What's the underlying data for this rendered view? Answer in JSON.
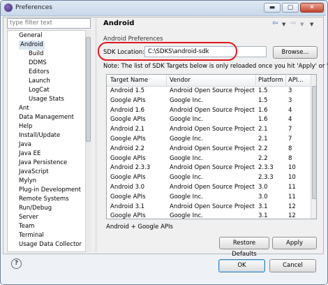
{
  "window": {
    "title": "Preferences",
    "minimize": "▬",
    "maximize": "▢",
    "close": "✕"
  },
  "filter": {
    "placeholder": "type filter text"
  },
  "tree": [
    {
      "label": "General",
      "indent": 0
    },
    {
      "label": "Android",
      "indent": 0,
      "selected": true
    },
    {
      "label": "Build",
      "indent": 1
    },
    {
      "label": "DDMS",
      "indent": 1
    },
    {
      "label": "Editors",
      "indent": 1
    },
    {
      "label": "Launch",
      "indent": 1
    },
    {
      "label": "LogCat",
      "indent": 1
    },
    {
      "label": "Usage Stats",
      "indent": 1
    },
    {
      "label": "Ant",
      "indent": 0
    },
    {
      "label": "Data Management",
      "indent": 0
    },
    {
      "label": "Help",
      "indent": 0
    },
    {
      "label": "Install/Update",
      "indent": 0
    },
    {
      "label": "Java",
      "indent": 0
    },
    {
      "label": "Java EE",
      "indent": 0
    },
    {
      "label": "Java Persistence",
      "indent": 0
    },
    {
      "label": "JavaScript",
      "indent": 0
    },
    {
      "label": "Mylyn",
      "indent": 0
    },
    {
      "label": "Plug-in Development",
      "indent": 0
    },
    {
      "label": "Remote Systems",
      "indent": 0
    },
    {
      "label": "Run/Debug",
      "indent": 0
    },
    {
      "label": "Server",
      "indent": 0
    },
    {
      "label": "Team",
      "indent": 0
    },
    {
      "label": "Terminal",
      "indent": 0
    },
    {
      "label": "Usage Data Collector",
      "indent": 0
    }
  ],
  "page": {
    "title": "Android",
    "section_label": "Android Preferences",
    "sdk_location_label": "SDK Location:",
    "sdk_location_value": "C:\\SDKS\\android-sdk",
    "browse_label": "Browse...",
    "note": "Note: The list of SDK Targets below is only reloaded once you hit 'Apply' or 'OK'.",
    "selected_status": "Android + Google APIs",
    "restore_label": "Restore Defaults",
    "apply_label": "Apply"
  },
  "table": {
    "headers": [
      "Target Name",
      "Vendor",
      "Platform",
      "API..."
    ],
    "rows": [
      [
        "Android 1.5",
        "Android Open Source Project",
        "1.5",
        "3"
      ],
      [
        "Google APIs",
        "Google Inc.",
        "1.5",
        "3"
      ],
      [
        "Android 1.6",
        "Android Open Source Project",
        "1.6",
        "4"
      ],
      [
        "Google APIs",
        "Google Inc.",
        "1.6",
        "4"
      ],
      [
        "Android 2.1",
        "Android Open Source Project",
        "2.1",
        "7"
      ],
      [
        "Google APIs",
        "Google Inc.",
        "2.1",
        "7"
      ],
      [
        "Android 2.2",
        "Android Open Source Project",
        "2.2",
        "8"
      ],
      [
        "Google APIs",
        "Google Inc.",
        "2.2",
        "8"
      ],
      [
        "Android 2.3.3",
        "Android Open Source Project",
        "2.3.3",
        "10"
      ],
      [
        "Google APIs",
        "Google Inc.",
        "2.3.3",
        "10"
      ],
      [
        "Android 3.0",
        "Android Open Source Project",
        "3.0",
        "11"
      ],
      [
        "Google APIs",
        "Google Inc.",
        "3.0",
        "11"
      ],
      [
        "Android 3.1",
        "Android Open Source Project",
        "3.1",
        "12"
      ],
      [
        "Google APIs",
        "Google Inc.",
        "3.1",
        "12"
      ]
    ]
  },
  "footer": {
    "help_icon": "?",
    "ok_label": "OK",
    "cancel_label": "Cancel"
  },
  "colors": {
    "highlight_ring": "#e0181f",
    "selection": "#dde7f4"
  }
}
